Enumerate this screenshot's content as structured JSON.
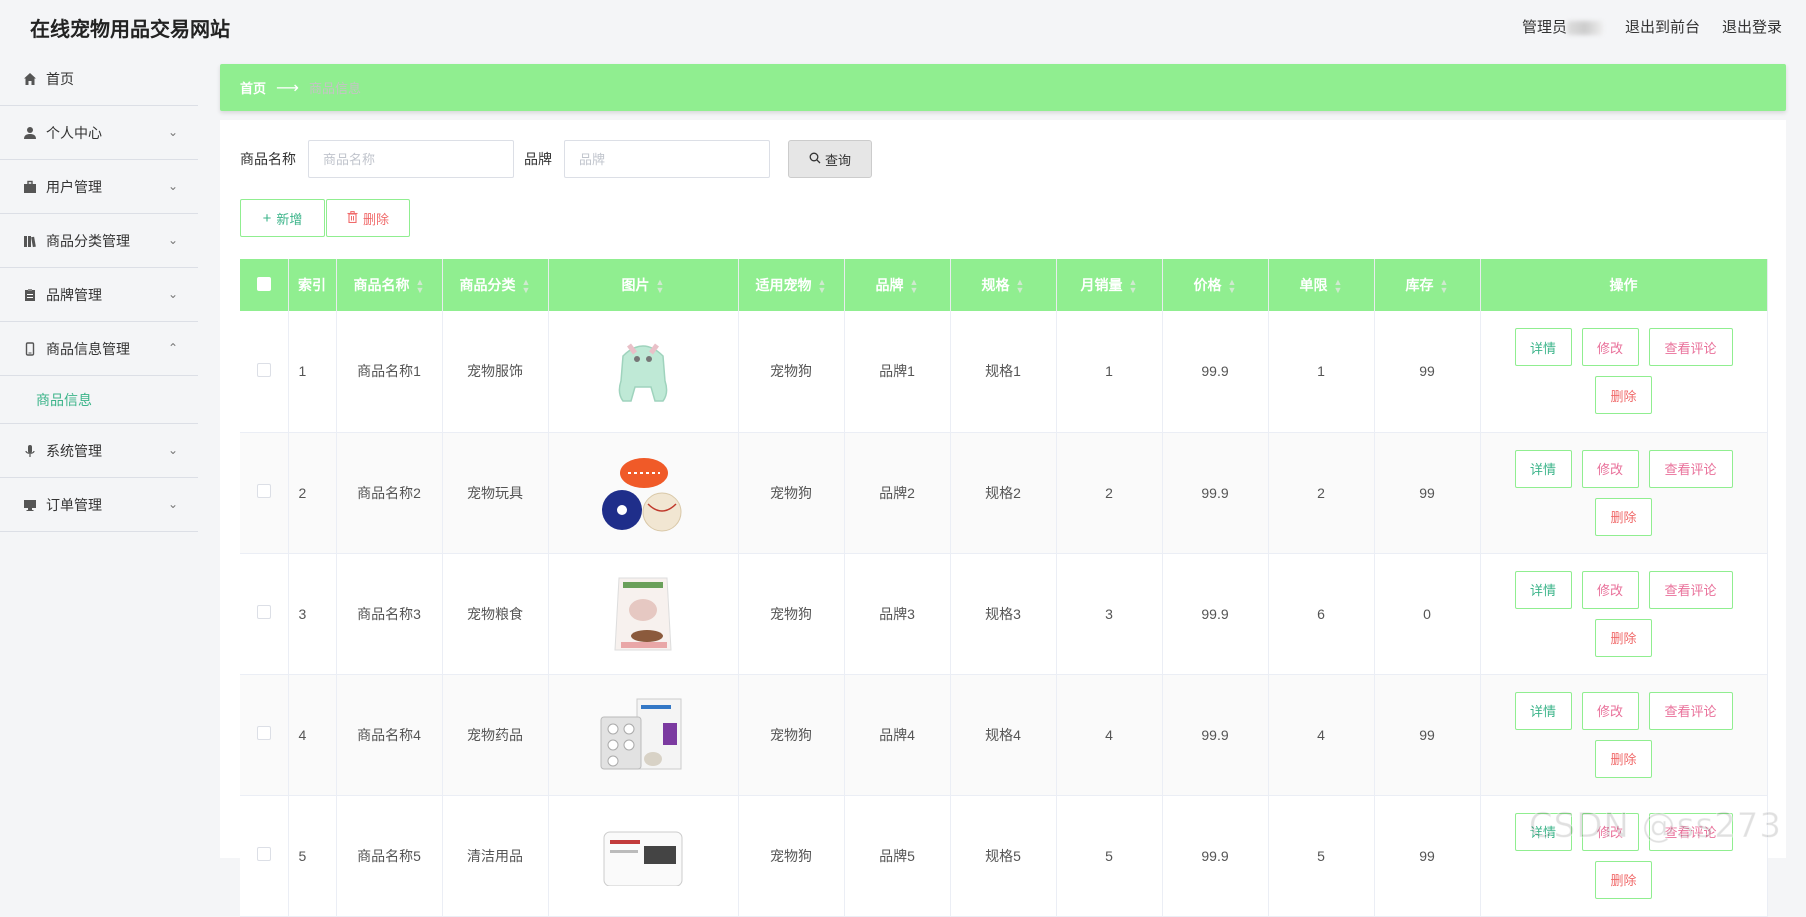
{
  "header": {
    "title": "在线宠物用品交易网站",
    "admin_label": "管理员",
    "front_label": "退出到前台",
    "logout_label": "退出登录"
  },
  "sidebar": {
    "items": [
      {
        "label": "首页",
        "icon": "home-icon"
      },
      {
        "label": "个人中心",
        "icon": "user-icon"
      },
      {
        "label": "用户管理",
        "icon": "briefcase-icon"
      },
      {
        "label": "商品分类管理",
        "icon": "books-icon"
      },
      {
        "label": "品牌管理",
        "icon": "clipboard-icon"
      },
      {
        "label": "商品信息管理",
        "icon": "mobile-icon",
        "expanded": true,
        "sub": "商品信息"
      },
      {
        "label": "系统管理",
        "icon": "microphone-icon"
      },
      {
        "label": "订单管理",
        "icon": "monitor-icon"
      }
    ]
  },
  "breadcrumb": {
    "home": "首页",
    "current": "商品信息"
  },
  "search": {
    "name_label": "商品名称",
    "name_placeholder": "商品名称",
    "brand_label": "品牌",
    "brand_placeholder": "品牌",
    "query_label": "查询"
  },
  "actions": {
    "add_label": "新增",
    "delete_label": "删除"
  },
  "table": {
    "headers": [
      "索引",
      "商品名称",
      "商品分类",
      "图片",
      "适用宠物",
      "品牌",
      "规格",
      "月销量",
      "价格",
      "单限",
      "库存",
      "操作"
    ],
    "op_labels": {
      "detail": "详情",
      "edit": "修改",
      "review": "查看评论",
      "remove": "删除"
    },
    "rows": [
      {
        "index": "1",
        "name": "商品名称1",
        "category": "宠物服饰",
        "image": "pet-clothing-image",
        "pet": "宠物狗",
        "brand": "品牌1",
        "spec": "规格1",
        "sales": "1",
        "price": "99.9",
        "limit": "1",
        "stock": "99"
      },
      {
        "index": "2",
        "name": "商品名称2",
        "category": "宠物玩具",
        "image": "pet-toy-balls-image",
        "pet": "宠物狗",
        "brand": "品牌2",
        "spec": "规格2",
        "sales": "2",
        "price": "99.9",
        "limit": "2",
        "stock": "99"
      },
      {
        "index": "3",
        "name": "商品名称3",
        "category": "宠物粮食",
        "image": "pet-food-bag-image",
        "pet": "宠物狗",
        "brand": "品牌3",
        "spec": "规格3",
        "sales": "3",
        "price": "99.9",
        "limit": "6",
        "stock": "0"
      },
      {
        "index": "4",
        "name": "商品名称4",
        "category": "宠物药品",
        "image": "pet-medicine-box-image",
        "pet": "宠物狗",
        "brand": "品牌4",
        "spec": "规格4",
        "sales": "4",
        "price": "99.9",
        "limit": "4",
        "stock": "99"
      },
      {
        "index": "5",
        "name": "商品名称5",
        "category": "清洁用品",
        "image": "cleaning-wipes-image",
        "pet": "宠物狗",
        "brand": "品牌5",
        "spec": "规格5",
        "sales": "5",
        "price": "99.9",
        "limit": "5",
        "stock": "99"
      }
    ]
  },
  "watermark": "CSDN @ss273",
  "colors": {
    "accent": "#90ee90",
    "text_green": "#3cb48a",
    "text_pink": "#e9709a",
    "text_red": "#f06a6a"
  }
}
